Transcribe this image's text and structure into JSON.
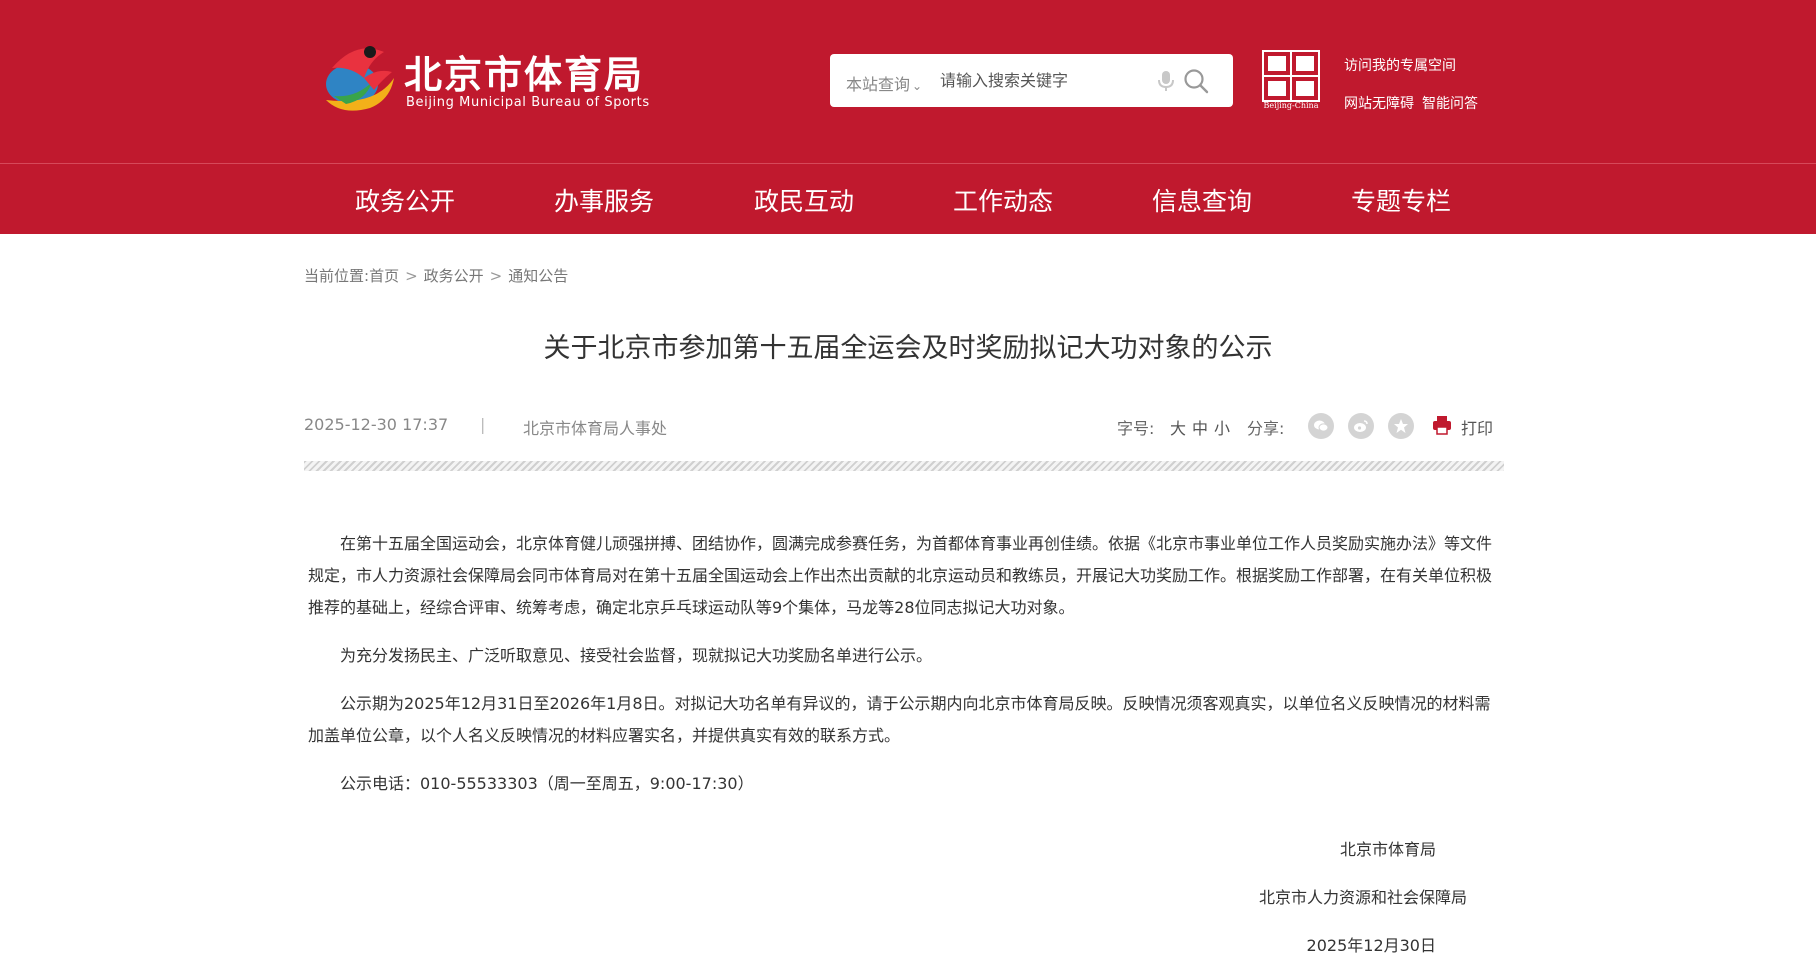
{
  "header": {
    "site_title": "北京市体育局",
    "site_subtitle": "Beijing Municipal Bureau of Sports",
    "search": {
      "scope_label": "本站查询",
      "placeholder": "请输入搜索关键字"
    },
    "badge_text": "Beijing-China",
    "links": {
      "personal_space": "访问我的专属空间",
      "accessibility": "网站无障碍",
      "smart_qa": "智能问答"
    }
  },
  "nav": {
    "items": [
      "政务公开",
      "办事服务",
      "政民互动",
      "工作动态",
      "信息查询",
      "专题专栏"
    ]
  },
  "breadcrumb": {
    "prefix": "当前位置:",
    "items": [
      "首页",
      "政务公开",
      "通知公告"
    ],
    "separator": ">"
  },
  "article": {
    "title": "关于北京市参加第十五届全运会及时奖励拟记大功对象的公示",
    "date": "2025-12-30 17:37",
    "divider": "|",
    "source": "北京市体育局人事处",
    "font_label": "字号:",
    "font_sizes": [
      "大",
      "中",
      "小"
    ],
    "share_label": "分享:",
    "print_label": "打印",
    "paragraphs": [
      "在第十五届全国运动会，北京体育健儿顽强拼搏、团结协作，圆满完成参赛任务，为首都体育事业再创佳绩。依据《北京市事业单位工作人员奖励实施办法》等文件规定，市人力资源社会保障局会同市体育局对在第十五届全国运动会上作出杰出贡献的北京运动员和教练员，开展记大功奖励工作。根据奖励工作部署，在有关单位积极推荐的基础上，经综合评审、统筹考虑，确定北京乒乓球运动队等9个集体，马龙等28位同志拟记大功对象。",
      "为充分发扬民主、广泛听取意见、接受社会监督，现就拟记大功奖励名单进行公示。",
      "公示期为2025年12月31日至2026年1月8日。对拟记大功名单有异议的，请于公示期内向北京市体育局反映。反映情况须客观真实，以单位名义反映情况的材料需加盖单位公章，以个人名义反映情况的材料应署实名，并提供真实有效的联系方式。",
      "公示电话：010-55533303（周一至周五，9:00-17:30）"
    ],
    "signatures": [
      "北京市体育局",
      "北京市人力资源和社会保障局",
      "2025年12月30日"
    ]
  },
  "colors": {
    "brand_red": "#c0192e",
    "text": "#333333",
    "muted": "#888888"
  },
  "icons": [
    "logo-icon",
    "chevron-down-icon",
    "microphone-icon",
    "search-icon",
    "capital-window-badge",
    "wechat-icon",
    "weibo-icon",
    "favorite-icon",
    "printer-icon"
  ]
}
